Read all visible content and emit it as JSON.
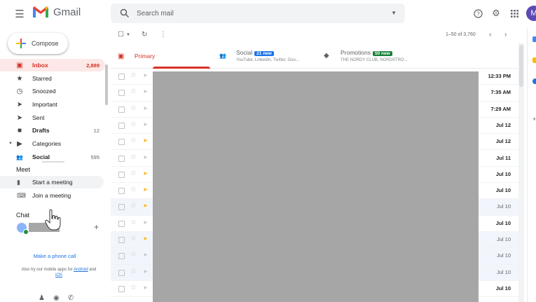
{
  "app": {
    "logo_text": "Gmail",
    "avatar_letter": "M"
  },
  "search": {
    "placeholder": "Search mail"
  },
  "colors": {
    "accent_red": "#d93025",
    "social_badge": "#1a73e8",
    "promo_badge": "#188038",
    "avatar": "#5c4ab4"
  },
  "icons": {
    "menu": "hamburger-menu-icon",
    "search": "search-icon",
    "help": "help-icon",
    "settings": "gear-icon",
    "apps": "apps-grid-icon"
  },
  "sidebar": {
    "compose_label": "Compose",
    "items": [
      {
        "label": "Inbox",
        "count": "2,889"
      },
      {
        "label": "Starred",
        "count": ""
      },
      {
        "label": "Snoozed",
        "count": ""
      },
      {
        "label": "Important",
        "count": ""
      },
      {
        "label": "Sent",
        "count": ""
      },
      {
        "label": "Drafts",
        "count": "12"
      },
      {
        "label": "Categories",
        "count": ""
      },
      {
        "label": "Social",
        "count": "595"
      }
    ],
    "meet": {
      "title": "Meet",
      "start": "Start a meeting",
      "join": "Join a meeting"
    },
    "chat": {
      "title": "Chat"
    },
    "phone_call": "Make a phone call",
    "apps_note_prefix": "Also try our mobile apps for",
    "apps_note_android": "Android",
    "apps_note_and": "and",
    "apps_note_ios": "iOS"
  },
  "toolbar": {
    "pager": "1–50 of 3,760"
  },
  "tabs": [
    {
      "name": "Primary",
      "badge": "",
      "sub": ""
    },
    {
      "name": "Social",
      "badge": "21 new",
      "sub": "YouTube, LinkedIn, Twitter, Goo..."
    },
    {
      "name": "Promotions",
      "badge": "50 new",
      "sub": "THE NORDY CLUB, NORDSTRO..."
    }
  ],
  "emails": [
    {
      "date": "12:33 PM",
      "read": false,
      "important": false
    },
    {
      "date": "7:35 AM",
      "read": false,
      "important": false
    },
    {
      "date": "7:29 AM",
      "read": false,
      "important": false
    },
    {
      "date": "Jul 12",
      "read": false,
      "important": false
    },
    {
      "date": "Jul 12",
      "read": false,
      "important": true
    },
    {
      "date": "Jul 11",
      "read": false,
      "important": false
    },
    {
      "date": "Jul 10",
      "read": false,
      "important": true
    },
    {
      "date": "Jul 10",
      "read": false,
      "important": true
    },
    {
      "date": "Jul 10",
      "read": true,
      "important": true
    },
    {
      "date": "Jul 10",
      "read": false,
      "important": false
    },
    {
      "date": "Jul 10",
      "read": true,
      "important": true
    },
    {
      "date": "Jul 10",
      "read": true,
      "important": false
    },
    {
      "date": "Jul 10",
      "read": true,
      "important": false
    },
    {
      "date": "Jul 10",
      "read": false,
      "important": false
    }
  ]
}
